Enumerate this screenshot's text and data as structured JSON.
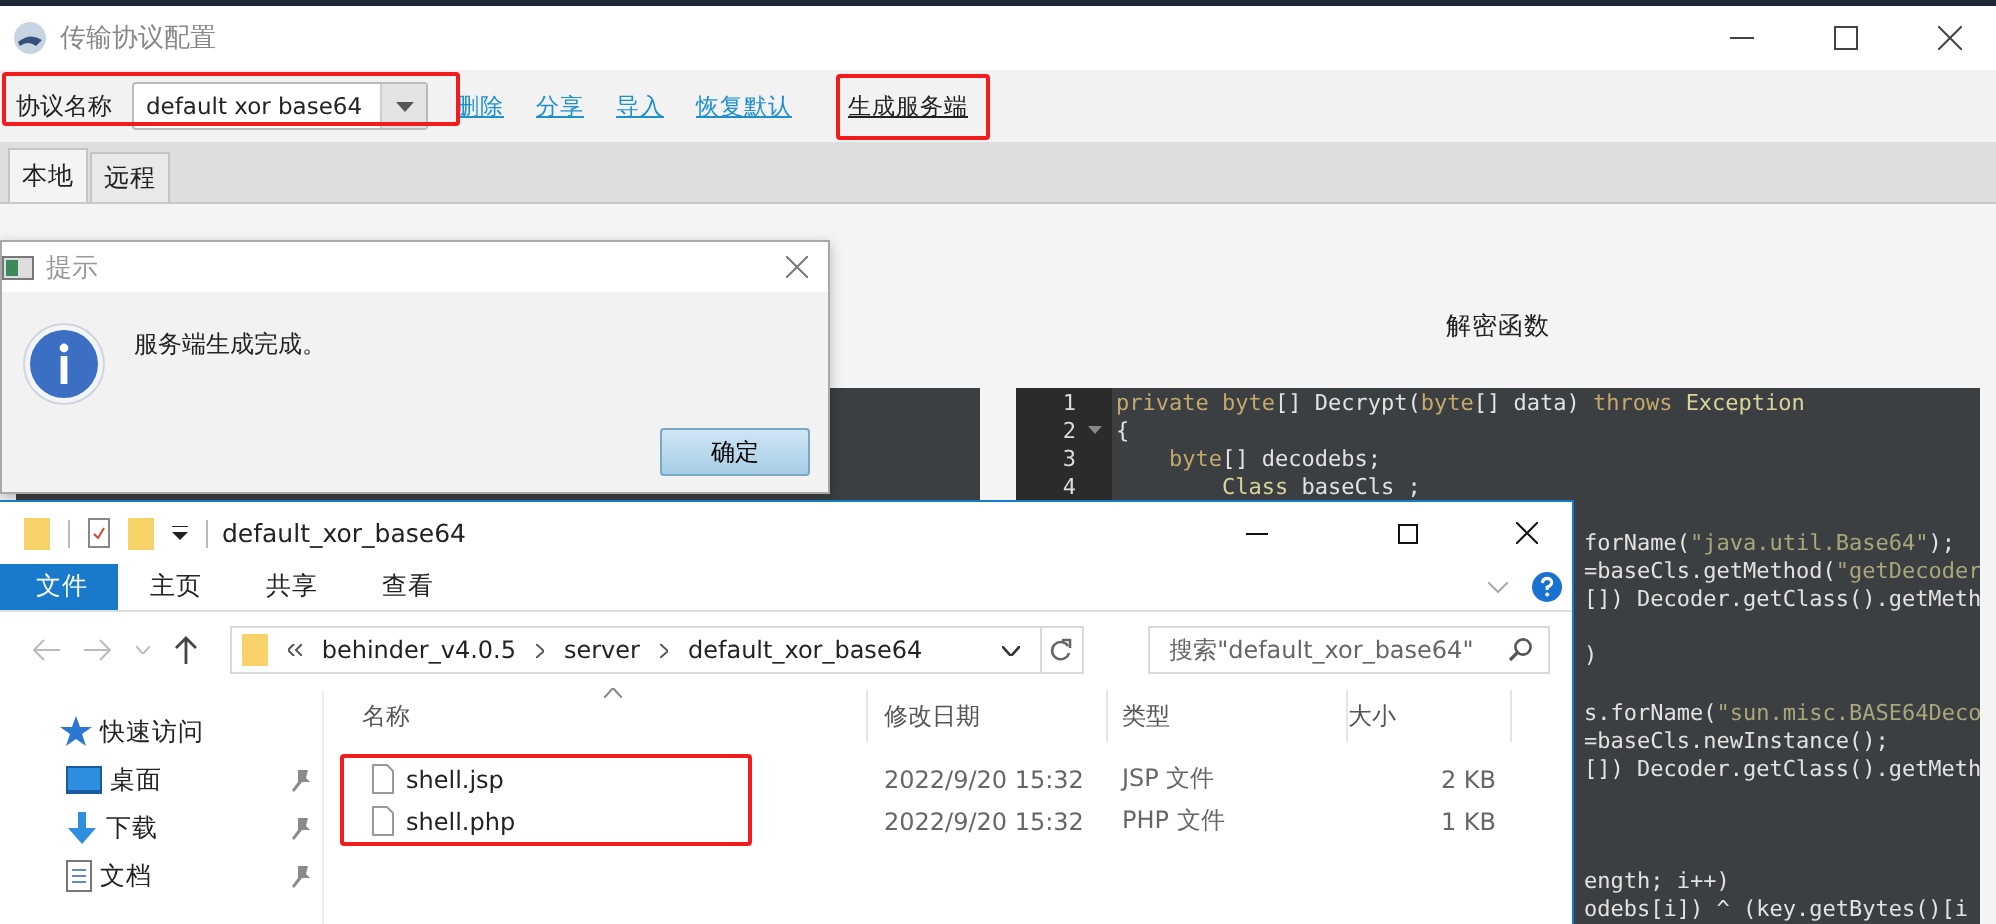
{
  "window": {
    "title": "传输协议配置"
  },
  "toolbar": {
    "protocol_label": "协议名称",
    "protocol_value": "default xor base64",
    "links": [
      {
        "label": "删除",
        "active": false
      },
      {
        "label": "分享",
        "active": false
      },
      {
        "label": "导入",
        "active": false
      },
      {
        "label": "恢复默认",
        "active": false
      },
      {
        "label": "生成服务端",
        "active": true
      }
    ]
  },
  "tabs": [
    {
      "label": "本地",
      "selected": true
    },
    {
      "label": "远程",
      "selected": false
    }
  ],
  "decrypt_editor": {
    "label": "解密函数",
    "lines": [
      {
        "kind": "line",
        "number": "1",
        "fold": false,
        "tokens": [
          {
            "t": "private ",
            "kind": "keyword"
          },
          {
            "t": "byte",
            "kind": "keyword"
          },
          {
            "t": "[] Decrypt(",
            "kind": "plain"
          },
          {
            "t": "byte",
            "kind": "keyword"
          },
          {
            "t": "[] data) ",
            "kind": "plain"
          },
          {
            "t": "throws ",
            "kind": "keyword"
          },
          {
            "t": "Exception",
            "kind": "type"
          }
        ]
      },
      {
        "kind": "line",
        "number": "2",
        "fold": true,
        "tokens": [
          {
            "t": "{",
            "kind": "plain"
          }
        ]
      },
      {
        "kind": "line",
        "number": "3",
        "fold": false,
        "tokens": [
          {
            "t": "    byte",
            "kind": "keyword"
          },
          {
            "t": "[] decodebs;",
            "kind": "plain"
          }
        ]
      },
      {
        "kind": "line",
        "number": "4",
        "fold": false,
        "tokens": [
          {
            "t": "        Class ",
            "kind": "type"
          },
          {
            "t": "baseCls ;",
            "kind": "plain"
          }
        ]
      },
      {
        "kind": "blank"
      },
      {
        "kind": "fragment",
        "tokens": [
          {
            "t": "forName(",
            "kind": "plain"
          },
          {
            "t": "\"java.util.Base64\"",
            "kind": "string"
          },
          {
            "t": ");",
            "kind": "plain"
          }
        ]
      },
      {
        "kind": "fragment",
        "tokens": [
          {
            "t": "=baseCls.getMethod(",
            "kind": "plain"
          },
          {
            "t": "\"getDecoder",
            "kind": "string"
          }
        ]
      },
      {
        "kind": "fragment",
        "tokens": [
          {
            "t": "[]) Decoder.getClass().getMeth",
            "kind": "plain"
          }
        ]
      },
      {
        "kind": "blank"
      },
      {
        "kind": "fragment",
        "tokens": [
          {
            "t": ")",
            "kind": "plain"
          }
        ]
      },
      {
        "kind": "blank"
      },
      {
        "kind": "fragment",
        "tokens": [
          {
            "t": "s.forName(",
            "kind": "plain"
          },
          {
            "t": "\"sun.misc.BASE64Deco",
            "kind": "string"
          }
        ]
      },
      {
        "kind": "fragment",
        "tokens": [
          {
            "t": "=baseCls.newInstance();",
            "kind": "plain"
          }
        ]
      },
      {
        "kind": "fragment",
        "tokens": [
          {
            "t": "[]) Decoder.getClass().getMeth",
            "kind": "plain"
          }
        ]
      },
      {
        "kind": "blank"
      },
      {
        "kind": "blank"
      },
      {
        "kind": "blank"
      },
      {
        "kind": "fragment",
        "tokens": [
          {
            "t": "ength; i++)",
            "kind": "plain"
          }
        ]
      },
      {
        "kind": "fragment",
        "tokens": [
          {
            "t": "odebs[i]) ^ (key.getBytes()[i",
            "kind": "plain"
          }
        ]
      }
    ]
  },
  "dialog": {
    "title": "提示",
    "message": "服务端生成完成。",
    "button": "确定"
  },
  "explorer": {
    "title": "default_xor_base64",
    "ribbon_tabs": [
      {
        "label": "文件",
        "selected": true
      },
      {
        "label": "主页",
        "selected": false
      },
      {
        "label": "共享",
        "selected": false
      },
      {
        "label": "查看",
        "selected": false
      }
    ],
    "breadcrumb": [
      "behinder_v4.0.5",
      "server",
      "default_xor_base64"
    ],
    "search": {
      "placeholder": "搜索\"default_xor_base64\""
    },
    "nav_items": [
      {
        "label": "快速访问",
        "kind": "quick",
        "pinned": false
      },
      {
        "label": "桌面",
        "kind": "desktop",
        "pinned": true
      },
      {
        "label": "下载",
        "kind": "download",
        "pinned": true
      },
      {
        "label": "文档",
        "kind": "document",
        "pinned": true
      }
    ],
    "columns": [
      "名称",
      "修改日期",
      "类型",
      "大小"
    ],
    "files": [
      {
        "name": "shell.jsp",
        "modified": "2022/9/20 15:32",
        "type": "JSP 文件",
        "size": "2 KB"
      },
      {
        "name": "shell.php",
        "modified": "2022/9/20 15:32",
        "type": "PHP 文件",
        "size": "1 KB"
      }
    ]
  }
}
